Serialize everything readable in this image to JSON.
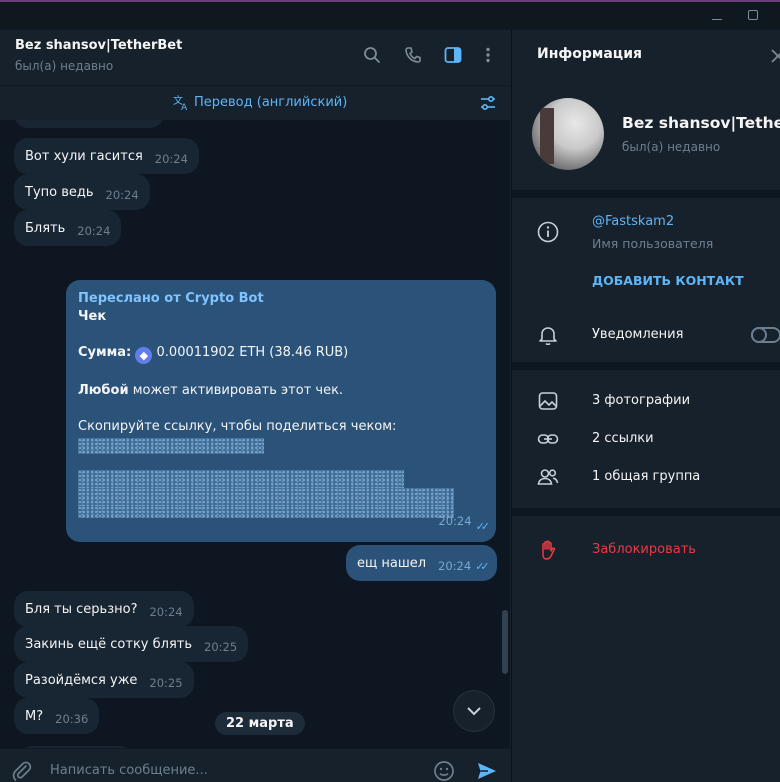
{
  "window": {
    "min_icon": "minimize-icon",
    "max_icon": "maximize-icon"
  },
  "chat": {
    "title": "Bez shansov|TetherBet",
    "status": "был(а) недавно",
    "header_icons": [
      "search-icon",
      "phone-icon",
      "sidebar-toggle-icon",
      "more-vertical-icon"
    ],
    "translate_label": "Перевод (английский)",
    "messages_in_top": [
      {
        "text": "Вот хули гасится",
        "time": "20:24"
      },
      {
        "text": "Тупо ведь",
        "time": "20:24"
      },
      {
        "text": "Блять",
        "time": "20:24"
      }
    ],
    "forward": {
      "from": "Переслано от Crypto Bot",
      "title": "Чек",
      "sum_label": "Сумма:",
      "sum_value": "0.00011902 ETH (38.46 RUB)",
      "any_bold": "Любой",
      "any_rest": "может активировать этот чек.",
      "copy_text": "Скопируйте ссылку, чтобы поделиться чеком:",
      "time": "20:24"
    },
    "message_out": {
      "text": "ещ нашел",
      "time": "20:24"
    },
    "messages_in_bottom": [
      {
        "text": "Бля ты серьзно?",
        "time": "20:24"
      },
      {
        "text": "Закинь ещё сотку блять",
        "time": "20:25"
      },
      {
        "text": "Разойдёмся уже",
        "time": "20:25"
      },
      {
        "text": "М?",
        "time": "20:36"
      }
    ],
    "date_separator": "22 марта",
    "compose_placeholder": "Написать сообщение..."
  },
  "info": {
    "title": "Информация",
    "name": "Bez shansov|Tethe...",
    "status": "был(а) недавно",
    "username": "@Fastskam2",
    "username_label": "Имя пользователя",
    "add_contact": "ДОБАВИТЬ КОНТАКТ",
    "notifications": "Уведомления",
    "notifications_on": false,
    "photos": "3 фотографии",
    "links": "2 ссылки",
    "groups": "1 общая группа",
    "block": "Заблокировать"
  },
  "colors": {
    "accent": "#5eb5f7",
    "outgoing": "#2b5278",
    "incoming": "#182533",
    "danger": "#ec3942"
  }
}
